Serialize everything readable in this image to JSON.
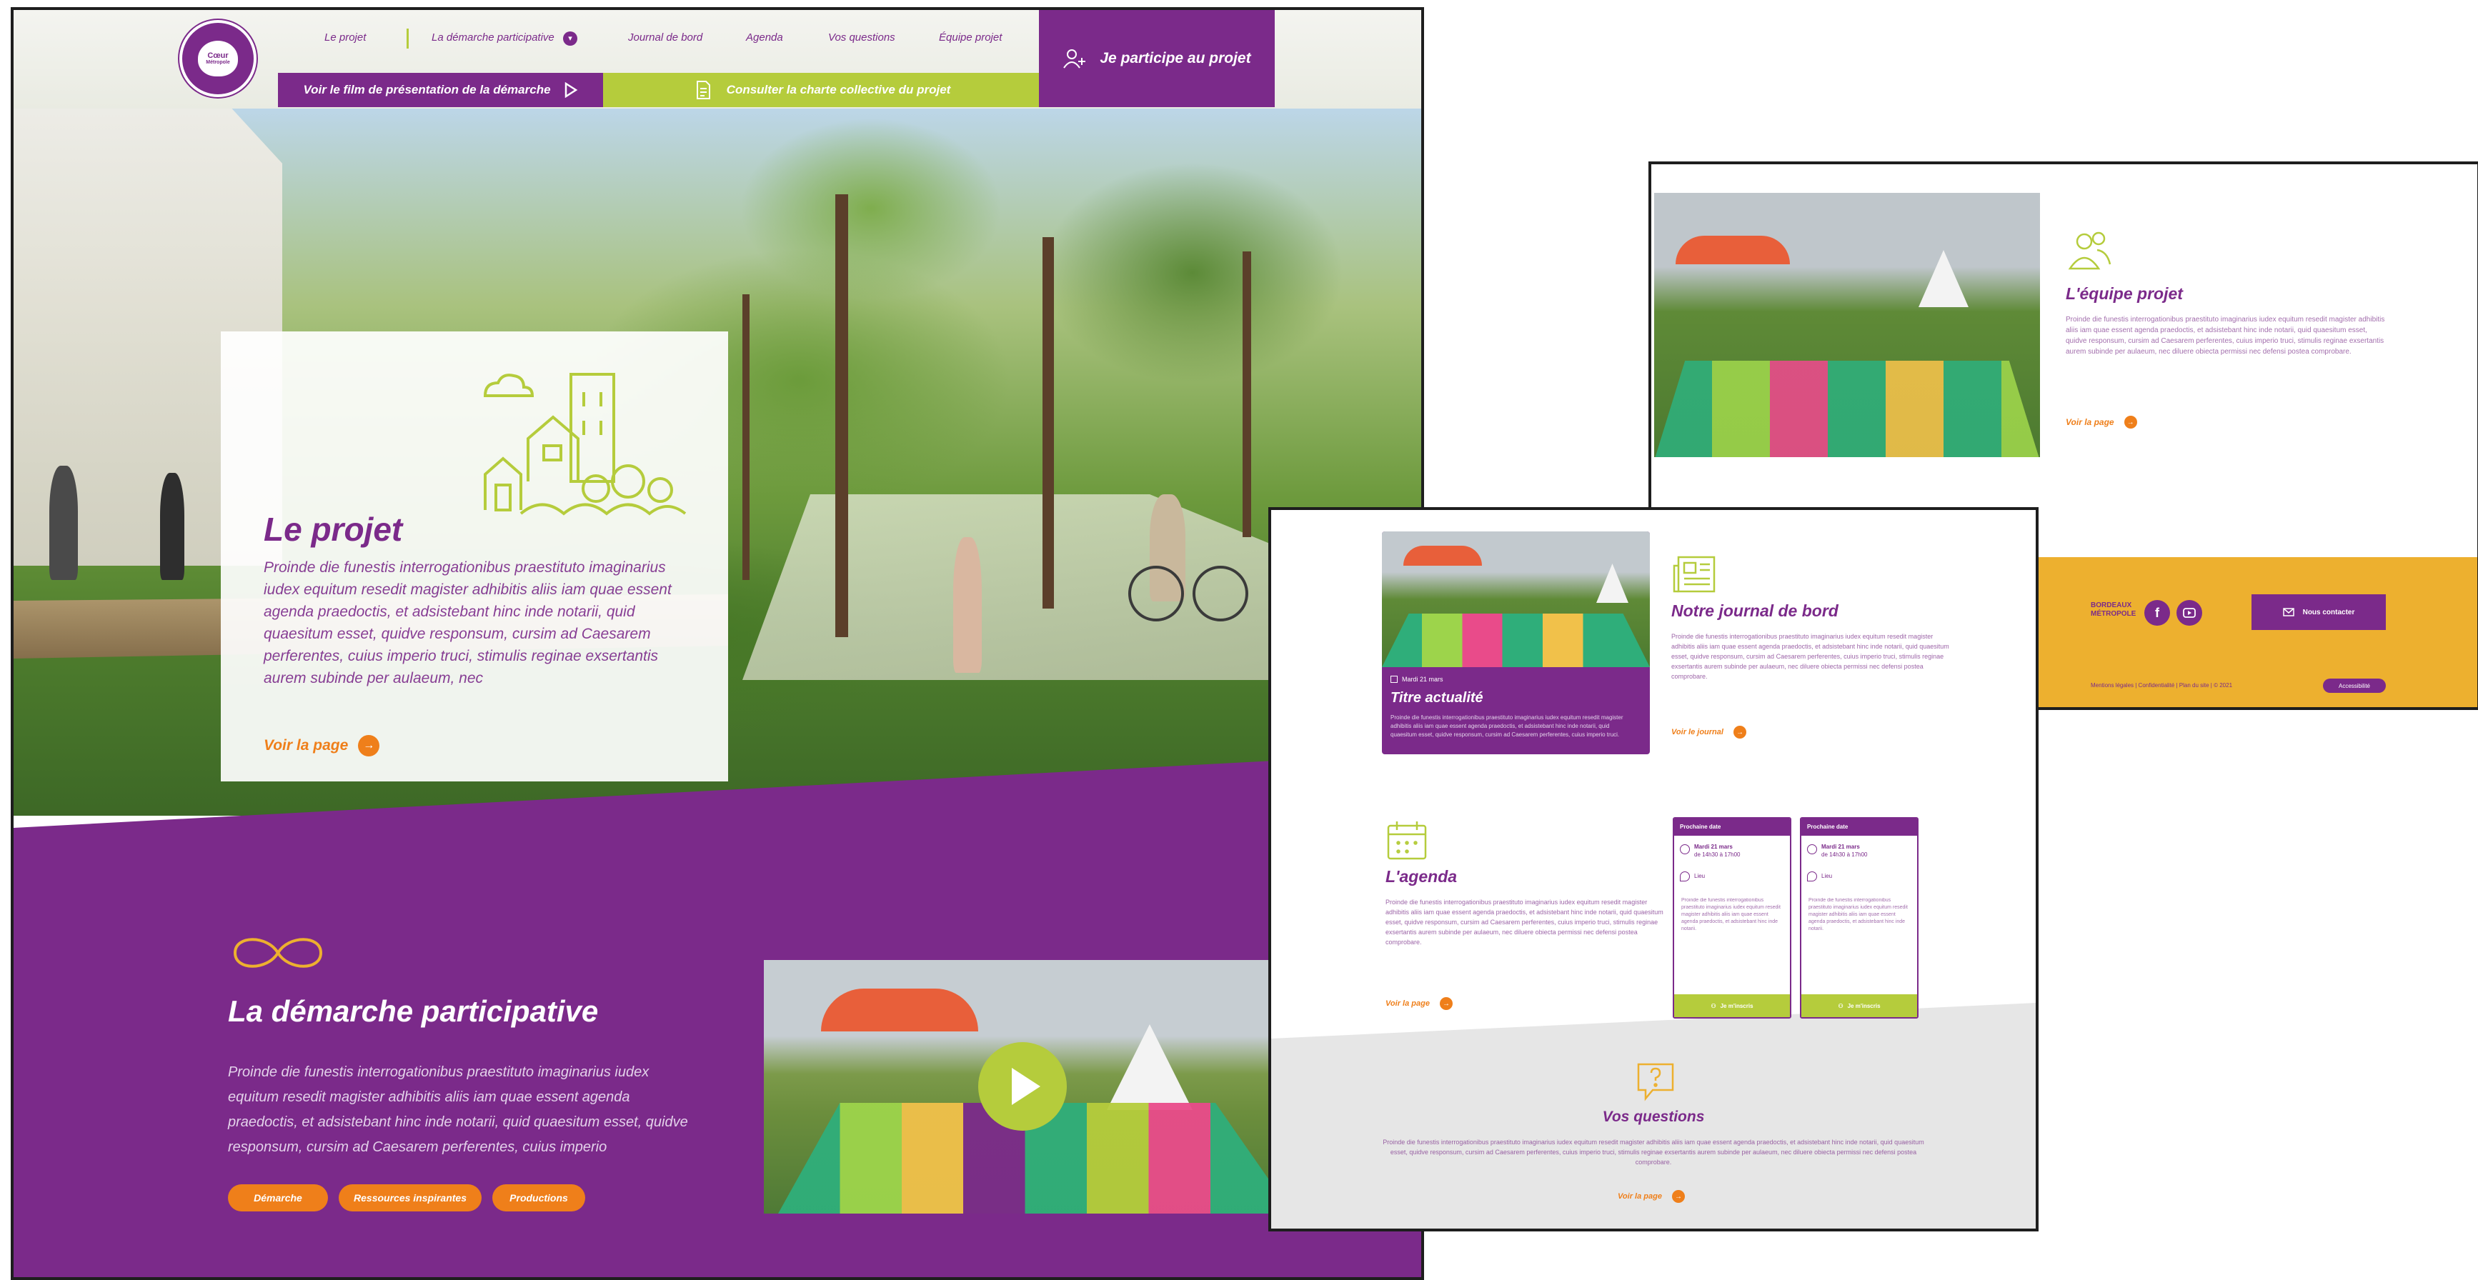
{
  "brand": {
    "purple": "#7b2a8a",
    "green": "#b5cc3c",
    "orange": "#ef7f1a",
    "yellow": "#edb02f"
  },
  "logo": {
    "line1": "Cœur",
    "line2": "Métropole"
  },
  "nav": {
    "items": [
      "Le projet",
      "La démarche participative",
      "Journal de bord",
      "Agenda",
      "Vos questions",
      "Équipe projet"
    ],
    "film_label": "Voir le film de présentation de la démarche",
    "charte_label": "Consulter la charte collective du projet",
    "participe_label": "Je participe au projet"
  },
  "projet": {
    "title": "Le projet",
    "text": "Proinde die funestis interrogationibus praestituto imaginarius iudex equitum resedit magister adhibitis aliis iam quae essent agenda praedoctis, et adsistebant hinc inde notarii, quid quaesitum esset, quidve responsum, cursim ad Caesarem perferentes, cuius imperio truci, stimulis reginae exsertantis aurem subinde per aulaeum, nec",
    "link": "Voir la page"
  },
  "demarche": {
    "title": "La démarche participative",
    "text": "Proinde die funestis interrogationibus praestituto imaginarius iudex equitum resedit magister adhibitis aliis iam quae essent agenda praedoctis, et adsistebant hinc inde notarii, quid quaesitum esset, quidve responsum, cursim ad Caesarem perferentes, cuius imperio",
    "pills": [
      "Démarche",
      "Ressources inspirantes",
      "Productions"
    ]
  },
  "equipe": {
    "title": "L'équipe projet",
    "text": "Proinde die funestis interrogationibus praestituto imaginarius iudex equitum resedit magister adhibitis aliis iam quae essent agenda praedoctis, et adsistebant hinc inde notarii, quid quaesitum esset, quidve responsum, cursim ad Caesarem perferentes, cuius imperio truci, stimulis reginae exsertantis aurem subinde per aulaeum, nec diluere obiecta permissi nec defensi postea comprobare.",
    "link": "Voir la page"
  },
  "footer": {
    "logo_line1": "BORDEAUX",
    "logo_line2": "MÉTROPOLE",
    "contact_label": "Nous contacter",
    "meta": "Mentions légales | Confidentialité | Plan du site | © 2021",
    "access_label": "Accessibilité"
  },
  "journal": {
    "date": "Mardi 21 mars",
    "actu_title": "Titre actualité",
    "actu_text": "Proinde die funestis interrogationibus praestituto imaginarius iudex equitum resedit magister adhibitis aliis iam quae essent agenda praedoctis, et adsistebant hinc inde notarii, quid quaesitum esset, quidve responsum, cursim ad Caesarem perferentes, cuius imperio truci.",
    "title": "Notre journal de bord",
    "text": "Proinde die funestis interrogationibus praestituto imaginarius iudex equitum resedit magister adhibitis aliis iam quae essent agenda praedoctis, et adsistebant hinc inde notarii, quid quaesitum esset, quidve responsum, cursim ad Caesarem perferentes, cuius imperio truci, stimulis reginae exsertantis aurem subinde per aulaeum, nec diluere obiecta permissi nec defensi postea comprobare.",
    "link": "Voir le journal"
  },
  "agenda": {
    "title": "L'agenda",
    "text": "Proinde die funestis interrogationibus praestituto imaginarius iudex equitum resedit magister adhibitis aliis iam quae essent agenda praedoctis, et adsistebant hinc inde notarii, quid quaesitum esset, quidve responsum, cursim ad Caesarem perferentes, cuius imperio truci, stimulis reginae exsertantis aurem subinde per aulaeum, nec diluere obiecta permissi nec defensi postea comprobare.",
    "link": "Voir la page",
    "events": [
      {
        "header": "Prochaine date",
        "date": "Mardi 21 mars",
        "time": "de 14h30 à 17h00",
        "place": "Lieu",
        "text": "Proinde die funestis interrogationibus praestituto imaginarius iudex equitum resedit magister adhibitis aliis iam quae essent agenda praedoctis, et adsistebant hinc inde notarii.",
        "button": "Je m'inscris"
      },
      {
        "header": "Prochaine date",
        "date": "Mardi 21 mars",
        "time": "de 14h30 à 17h00",
        "place": "Lieu",
        "text": "Proinde die funestis interrogationibus praestituto imaginarius iudex equitum resedit magister adhibitis aliis iam quae essent agenda praedoctis, et adsistebant hinc inde notarii.",
        "button": "Je m'inscris"
      }
    ]
  },
  "questions": {
    "title": "Vos questions",
    "text": "Proinde die funestis interrogationibus praestituto imaginarius iudex equitum resedit magister adhibitis aliis iam quae essent agenda praedoctis, et adsistebant hinc inde notarii, quid quaesitum esset, quidve responsum, cursim ad Caesarem perferentes, cuius imperio truci, stimulis reginae exsertantis aurem subinde per aulaeum, nec diluere obiecta permissi nec defensi postea comprobare.",
    "link": "Voir la page"
  }
}
